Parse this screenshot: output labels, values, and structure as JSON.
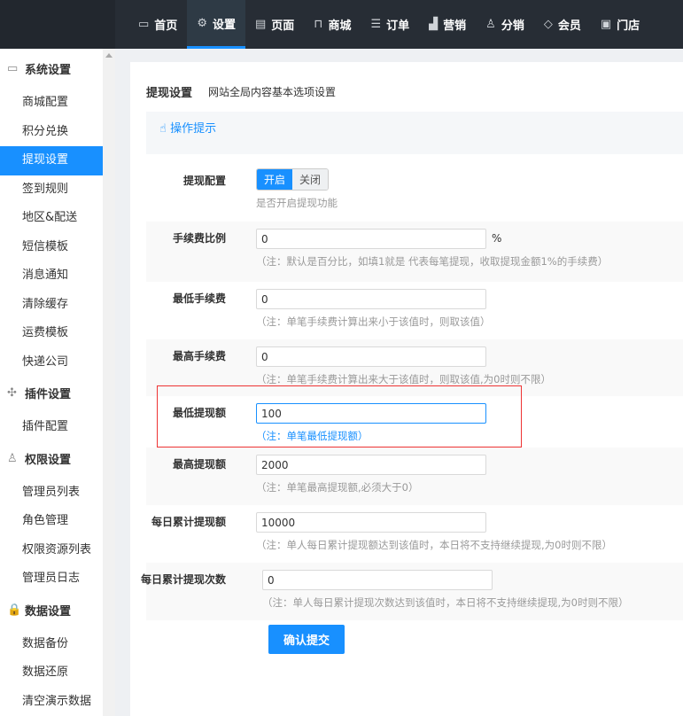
{
  "topnav": [
    {
      "icon": "monitor-icon",
      "glyph": "▭",
      "label": "首页"
    },
    {
      "icon": "gear-icon",
      "glyph": "⚙",
      "label": "设置",
      "active": true
    },
    {
      "icon": "page-icon",
      "glyph": "▤",
      "label": "页面"
    },
    {
      "icon": "bag-icon",
      "glyph": "⊓",
      "label": "商城"
    },
    {
      "icon": "clipboard-icon",
      "glyph": "☰",
      "label": "订单"
    },
    {
      "icon": "chart-icon",
      "glyph": "▟",
      "label": "营销"
    },
    {
      "icon": "users-icon",
      "glyph": "♙",
      "label": "分销"
    },
    {
      "icon": "diamond-icon",
      "glyph": "◇",
      "label": "会员"
    },
    {
      "icon": "store-icon",
      "glyph": "▣",
      "label": "门店"
    }
  ],
  "sidebar": [
    {
      "type": "group",
      "icon": "monitor-icon",
      "glyph": "▭",
      "label": "系统设置"
    },
    {
      "type": "item",
      "label": "商城配置"
    },
    {
      "type": "item",
      "label": "积分兑换"
    },
    {
      "type": "item",
      "label": "提现设置",
      "active": true
    },
    {
      "type": "item",
      "label": "签到规则"
    },
    {
      "type": "item",
      "label": "地区&配送"
    },
    {
      "type": "item",
      "label": "短信模板"
    },
    {
      "type": "item",
      "label": "消息通知"
    },
    {
      "type": "item",
      "label": "清除缓存"
    },
    {
      "type": "item",
      "label": "运费模板"
    },
    {
      "type": "item",
      "label": "快递公司"
    },
    {
      "type": "group",
      "icon": "puzzle-icon",
      "glyph": "✣",
      "label": "插件设置"
    },
    {
      "type": "item",
      "label": "插件配置"
    },
    {
      "type": "group",
      "icon": "user-icon",
      "glyph": "♙",
      "label": "权限设置"
    },
    {
      "type": "item",
      "label": "管理员列表"
    },
    {
      "type": "item",
      "label": "角色管理"
    },
    {
      "type": "item",
      "label": "权限资源列表"
    },
    {
      "type": "item",
      "label": "管理员日志"
    },
    {
      "type": "group",
      "icon": "lock-icon",
      "glyph": "🔒",
      "label": "数据设置"
    },
    {
      "type": "item",
      "label": "数据备份"
    },
    {
      "type": "item",
      "label": "数据还原"
    },
    {
      "type": "item",
      "label": "清空演示数据"
    }
  ],
  "page": {
    "title": "提现设置",
    "subtitle": "网站全局内容基本选项设置",
    "tip": "操作提示"
  },
  "form": {
    "switch": {
      "label": "提现配置",
      "on": "开启",
      "off": "关闭",
      "value": "开启",
      "note": "是否开启提现功能"
    },
    "fields": [
      {
        "label": "手续费比例",
        "value": "0",
        "unit": "%",
        "note": "（注：默认是百分比，如填1就是 代表每笔提现，收取提现金额1%的手续费）"
      },
      {
        "label": "最低手续费",
        "value": "0",
        "note": "（注：单笔手续费计算出来小于该值时，则取该值）"
      },
      {
        "label": "最高手续费",
        "value": "0",
        "note": "（注：单笔手续费计算出来大于该值时，则取该值,为0时则不限）"
      },
      {
        "label": "最低提现额",
        "value": "100",
        "note": "（注：单笔最低提现额）",
        "focused": true
      },
      {
        "label": "最高提现额",
        "value": "2000",
        "note": "（注：单笔最高提现额,必须大于0）"
      },
      {
        "label": "每日累计提现额",
        "value": "10000",
        "note": "（注：单人每日累计提现额达到该值时，本日将不支持继续提现,为0时则不限）"
      },
      {
        "label": "每日累计提现次数",
        "value": "0",
        "note": "（注：单人每日累计提现次数达到该值时，本日将不支持继续提现,为0时则不限）"
      }
    ],
    "submit": "确认提交"
  },
  "colors": {
    "accent": "#1890ff",
    "topbar": "#272d35",
    "highlight": "#e33333"
  }
}
